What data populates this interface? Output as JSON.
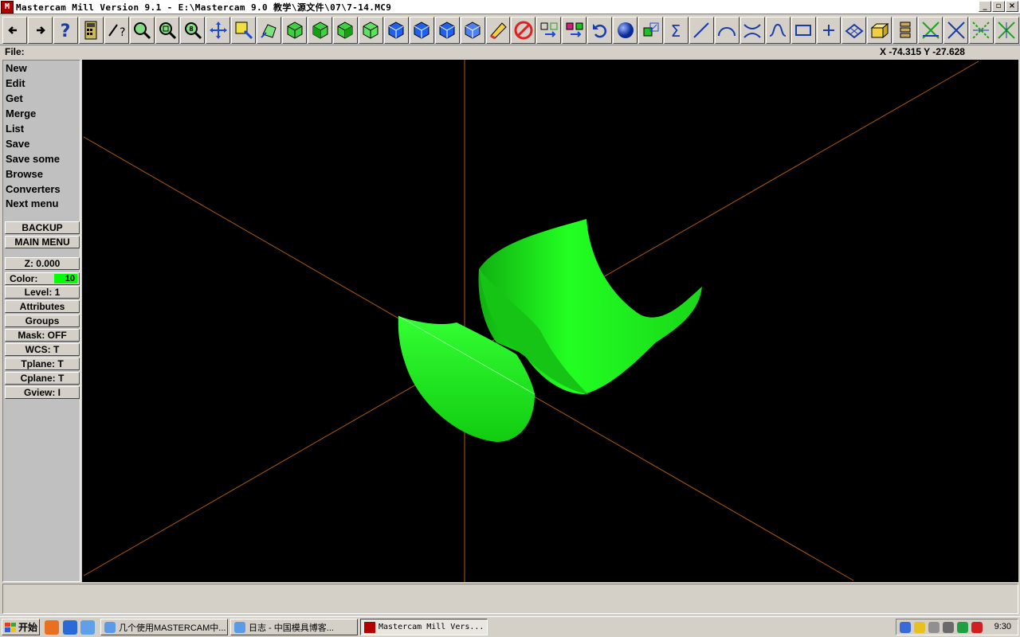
{
  "window": {
    "title": "Mastercam Mill Version 9.1 - E:\\Mastercam 9.0 教学\\源文件\\07\\7-14.MC9",
    "app_icon_text": "M",
    "buttons": [
      "_",
      "▫",
      "×"
    ]
  },
  "prompt": {
    "label": "File:",
    "coords": "X -74.315  Y -27.628"
  },
  "menu": {
    "items": [
      "New",
      "Edit",
      "Get",
      "Merge",
      "List",
      "Save",
      "Save some",
      "Browse",
      "Converters",
      "Next menu"
    ],
    "backup": "BACKUP",
    "main_menu": "MAIN MENU",
    "z": "Z:   0.000",
    "color_label": "Color:",
    "color_value": "10",
    "level": "Level:  1",
    "attributes": "Attributes",
    "groups": "Groups",
    "mask": "Mask:  OFF",
    "wcs": "WCS:   T",
    "tplane": "Tplane:  T",
    "cplane": "Cplane:  T",
    "gview": "Gview:   I"
  },
  "toolbar": {
    "icons": [
      "arrow-left-icon",
      "arrow-right-icon",
      "help-icon",
      "calculator-icon",
      "analyze-icon",
      "zoom-window-icon",
      "unzoom-icon",
      "zoom-fit-icon",
      "pan-icon",
      "select-icon",
      "rotate-view-icon",
      "view-top-icon",
      "view-front-icon",
      "view-side-icon",
      "view-iso-icon",
      "cube-top-icon",
      "cube-front-icon",
      "cube-side-icon",
      "cube-iso-icon",
      "eraser-icon",
      "no-delete-icon",
      "transform-icon",
      "xform-icon",
      "undo-icon",
      "sphere-icon",
      "solid-icon",
      "sum-icon",
      "line-icon",
      "arc-icon",
      "trim-icon",
      "spline-icon",
      "rectangle-icon",
      "point-icon",
      "surface-icon",
      "box-icon",
      "layers-icon",
      "intersect-icon",
      "break-icon",
      "divide-icon",
      "tool-icon"
    ]
  },
  "viewport": {
    "background": "#000000",
    "axis_color": "#b05a10",
    "surface_color": "#00ee00"
  },
  "taskbar": {
    "start": "开始",
    "tasks": [
      "几个使用MASTERCAM中...",
      "日志 - 中国模具博客...",
      "Mastercam Mill Vers..."
    ],
    "clock": "9:30"
  }
}
